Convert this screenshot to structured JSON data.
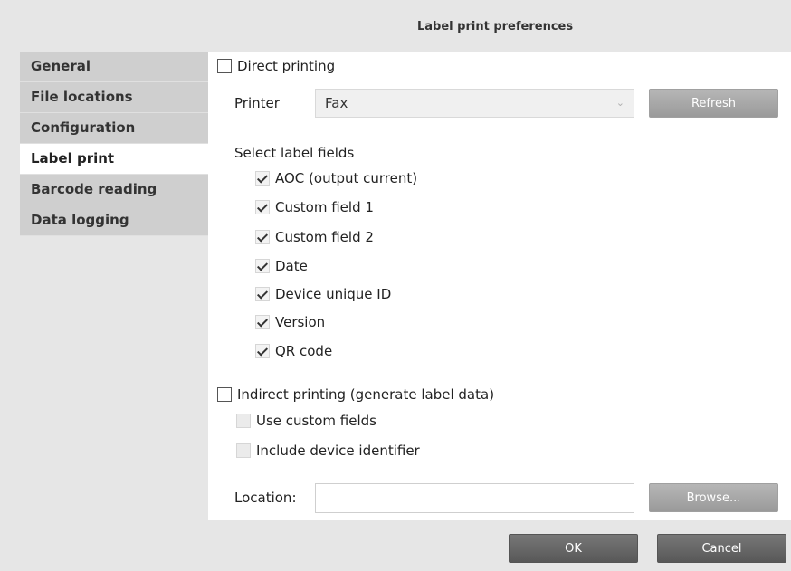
{
  "dialog": {
    "title": "Label print preferences"
  },
  "sidebar": {
    "items": [
      {
        "label": "General"
      },
      {
        "label": "File locations"
      },
      {
        "label": "Configuration"
      },
      {
        "label": "Label print"
      },
      {
        "label": "Barcode reading"
      },
      {
        "label": "Data logging"
      }
    ],
    "active": "Label print"
  },
  "direct_printing": {
    "label": "Direct printing",
    "checked": false,
    "printer_label": "Printer",
    "printer_value": "Fax",
    "refresh_label": "Refresh",
    "select_fields_label": "Select label fields",
    "fields": [
      {
        "label": "AOC (output current)",
        "checked": true
      },
      {
        "label": "Custom field 1",
        "checked": true
      },
      {
        "label": "Custom field 2",
        "checked": true
      },
      {
        "label": "Date",
        "checked": true
      },
      {
        "label": "Device unique ID",
        "checked": true
      },
      {
        "label": "Version",
        "checked": true
      },
      {
        "label": "QR code",
        "checked": true
      }
    ]
  },
  "indirect_printing": {
    "label": "Indirect printing (generate label data)",
    "checked": false,
    "use_custom_fields_label": "Use custom fields",
    "include_device_identifier_label": "Include device identifier",
    "location_label": "Location:",
    "location_value": "",
    "browse_label": "Browse..."
  },
  "footer": {
    "ok_label": "OK",
    "cancel_label": "Cancel"
  },
  "colors": {
    "sidebar_bg": "#cfcfcf",
    "active_bg": "#ffffff",
    "button_bg": "#6d6d6d",
    "window_bg": "#e6e6e6"
  }
}
